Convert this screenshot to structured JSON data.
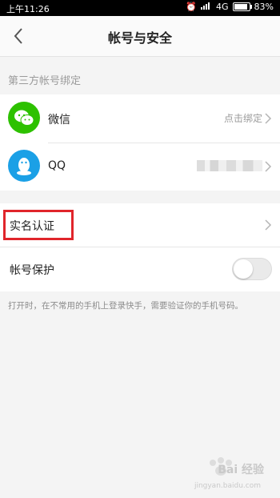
{
  "status_bar": {
    "time": "上午11:26",
    "network": "4G",
    "battery": "83%",
    "battery_level": 0.83
  },
  "header": {
    "title": "帐号与安全",
    "back_icon": "chevron-left-icon"
  },
  "third_party": {
    "section_label": "第三方帐号绑定",
    "items": [
      {
        "label": "微信",
        "status": "点击绑定",
        "icon": "wechat-icon",
        "color": "#2dc100"
      },
      {
        "label": "QQ",
        "status": "",
        "icon": "qq-icon",
        "color": "#1ba0e6"
      }
    ]
  },
  "security": {
    "real_name_label": "实名认证",
    "protection_label": "帐号保护",
    "protection_enabled": false,
    "hint": "打开时，在不常用的手机上登录快手，需要验证你的手机号码。"
  },
  "watermark": {
    "text": "Bai 经验",
    "sub": "jingyan.baidu.com"
  },
  "colors": {
    "highlight": "#e0252b",
    "background": "#f4f4f4"
  }
}
